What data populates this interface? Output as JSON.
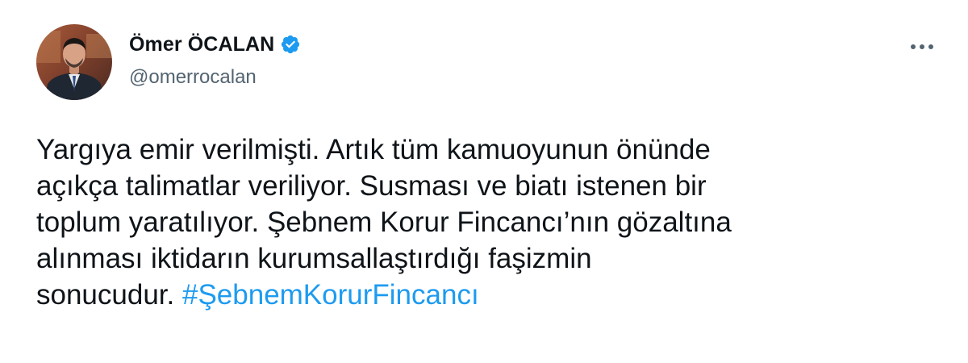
{
  "tweet": {
    "author": {
      "display_name": "Ömer ÖCALAN",
      "handle": "@omerrocalan",
      "verified": true
    },
    "text_lines": [
      "Yargıya emir verilmişti. Artık tüm kamuoyunun önünde",
      "açıkça talimatlar veriliyor. Susması ve biatı istenen bir",
      "toplum yaratılıyor. Şebnem Korur Fincancı’nın gözaltına",
      "alınması iktidarın kurumsallaştırdığı faşizmin",
      "sonucudur."
    ],
    "hashtag": "#ŞebnemKorurFincancı"
  },
  "icons": {
    "verified": "verified-badge-icon",
    "more": "more-options-icon"
  },
  "colors": {
    "text_primary": "#0f1419",
    "text_secondary": "#536471",
    "accent": "#1d9bf0",
    "background": "#ffffff"
  }
}
